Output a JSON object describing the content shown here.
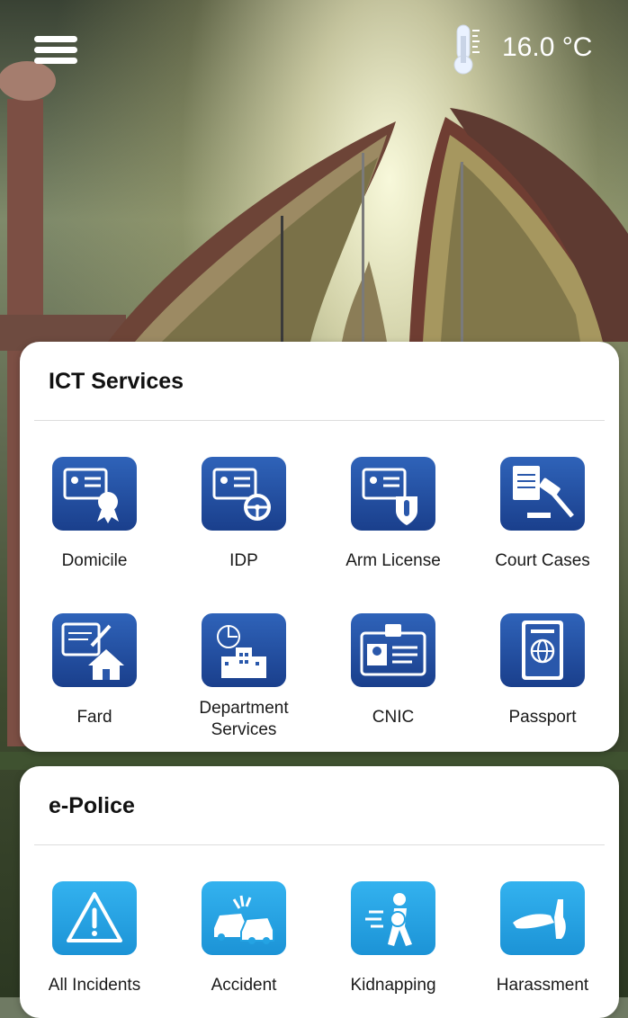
{
  "header": {
    "menu_icon": "hamburger-menu-icon",
    "weather_icon": "thermometer-icon",
    "temperature": "16.0 °C"
  },
  "ict_services": {
    "title": "ICT Services",
    "items": [
      {
        "label": "Domicile",
        "icon": "id-card-badge-icon"
      },
      {
        "label": "IDP",
        "icon": "id-card-steering-wheel-icon"
      },
      {
        "label": "Arm License",
        "icon": "id-card-bullet-icon"
      },
      {
        "label": "Court Cases",
        "icon": "gavel-document-icon"
      },
      {
        "label": "Fard",
        "icon": "document-house-icon"
      },
      {
        "label": "Department Services",
        "label_line1": "Department",
        "label_line2": "Services",
        "icon": "building-icon"
      },
      {
        "label": "CNIC",
        "icon": "id-card-icon"
      },
      {
        "label": "Passport",
        "icon": "passport-icon"
      }
    ]
  },
  "e_police": {
    "title": "e-Police",
    "items": [
      {
        "label": "All Incidents",
        "icon": "warning-triangle-icon"
      },
      {
        "label": "Accident",
        "icon": "car-crash-icon"
      },
      {
        "label": "Kidnapping",
        "icon": "kidnapping-icon"
      },
      {
        "label": "Harassment",
        "icon": "harassment-hand-icon"
      }
    ]
  },
  "colors": {
    "ict_icon_bg": "#1f4a9e",
    "police_icon_bg": "#24a3e3",
    "card_bg": "#ffffff",
    "header_text": "#ffffff"
  }
}
